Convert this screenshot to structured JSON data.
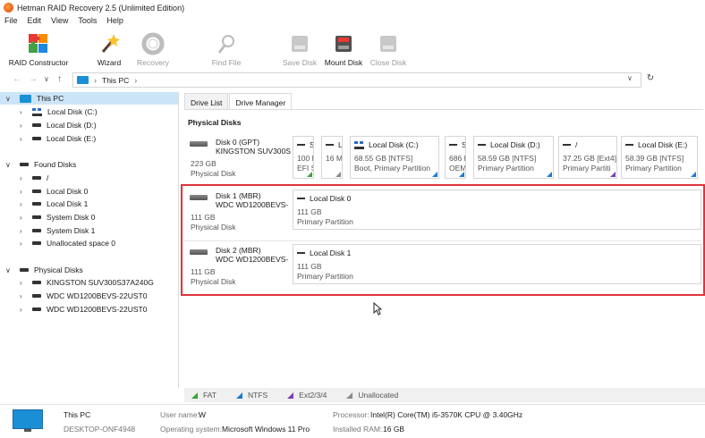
{
  "window": {
    "title": "Hetman RAID Recovery 2.5 (Unlimited Edition)"
  },
  "menu": [
    "File",
    "Edit",
    "View",
    "Tools",
    "Help"
  ],
  "toolbar": {
    "raid_constructor": "RAID Constructor",
    "wizard": "Wizard",
    "recovery": "Recovery",
    "find_file": "Find File",
    "save_disk": "Save Disk",
    "mount_disk": "Mount Disk",
    "close_disk": "Close Disk"
  },
  "address": {
    "path": "This PC"
  },
  "tree": {
    "this_pc": "This PC",
    "this_pc_children": [
      "Local Disk (C:)",
      "Local Disk (D:)",
      "Local Disk (E:)"
    ],
    "found_disks": "Found Disks",
    "found_children": [
      "/",
      "Local Disk 0",
      "Local Disk 1",
      "System Disk 0",
      "System Disk 1",
      "Unallocated space 0"
    ],
    "physical_disks": "Physical Disks",
    "physical_children": [
      "KINGSTON SUV300S37A240G",
      "WDC WD1200BEVS-22UST0",
      "WDC WD1200BEVS-22UST0"
    ]
  },
  "tabs": {
    "drive_list": "Drive List",
    "drive_manager": "Drive Manager"
  },
  "main": {
    "section_title": "Physical Disks",
    "disks": [
      {
        "name": "Disk 0 (GPT)",
        "model": "KINGSTON SUV300S",
        "size": "223 GB",
        "type": "Physical Disk",
        "partitions": [
          {
            "name": "S",
            "size": "100 M",
            "type": "EFI S"
          },
          {
            "name": "L",
            "size": "16 M",
            "type": ""
          },
          {
            "name": "Local Disk (C:)",
            "size": "68.55 GB [NTFS]",
            "type": "Boot, Primary Partition"
          },
          {
            "name": "S",
            "size": "686 M",
            "type": "OEM"
          },
          {
            "name": "Local Disk (D:)",
            "size": "58.59 GB [NTFS]",
            "type": "Primary Partition"
          },
          {
            "name": "/",
            "size": "37.25 GB [Ext4]",
            "type": "Primary Partiti"
          },
          {
            "name": "Local Disk (E:)",
            "size": "58.39 GB [NTFS]",
            "type": "Primary Partition"
          }
        ]
      },
      {
        "name": "Disk 1 (MBR)",
        "model": "WDC WD1200BEVS-",
        "size": "111 GB",
        "type": "Physical Disk",
        "partitions": [
          {
            "name": "Local Disk 0",
            "size": "111 GB",
            "type": "Primary Partition"
          }
        ]
      },
      {
        "name": "Disk 2 (MBR)",
        "model": "WDC WD1200BEVS-",
        "size": "111 GB",
        "type": "Physical Disk",
        "partitions": [
          {
            "name": "Local Disk 1",
            "size": "111 GB",
            "type": "Primary Partition"
          }
        ]
      }
    ]
  },
  "legend": [
    {
      "label": "FAT",
      "color": "#3aa33a"
    },
    {
      "label": "NTFS",
      "color": "#1d7ad6"
    },
    {
      "label": "Ext2/3/4",
      "color": "#7a3fb8"
    },
    {
      "label": "Unallocated",
      "color": "#8a8a8a"
    }
  ],
  "status": {
    "pc_name": "This PC",
    "pc_id": "DESKTOP-ONF4948",
    "user_label": "User name:",
    "user_value": "W",
    "os_label": "Operating system:",
    "os_value": "Microsoft Windows 11 Pro",
    "cpu_label": "Processor:",
    "cpu_value": "Intel(R) Core(TM) i5-3570K CPU @ 3.40GHz",
    "ram_label": "Installed RAM:",
    "ram_value": "16 GB"
  }
}
